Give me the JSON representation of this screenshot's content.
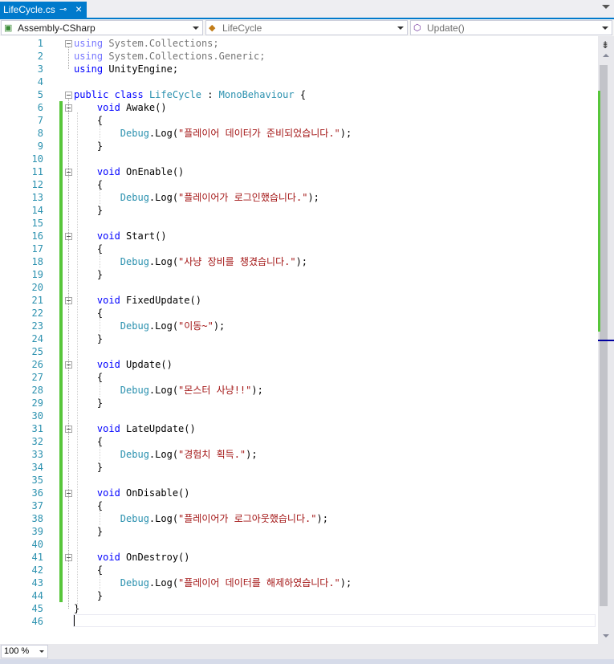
{
  "tab": {
    "title": "LifeCycle.cs",
    "pin_icon": "pin-icon",
    "close_icon": "close-icon"
  },
  "navbar": {
    "project": "Assembly-CSharp",
    "type": "LifeCycle",
    "member": "Update()"
  },
  "code_lines": [
    {
      "n": "1",
      "segs": [
        [
          "kw dim",
          "using"
        ],
        [
          "dim",
          " System.Collections;"
        ]
      ],
      "fold": true
    },
    {
      "n": "2",
      "segs": [
        [
          "kw dim",
          "using"
        ],
        [
          "dim",
          " System.Collections.Generic;"
        ]
      ]
    },
    {
      "n": "3",
      "segs": [
        [
          "kw",
          "using"
        ],
        [
          "",
          " UnityEngine;"
        ]
      ]
    },
    {
      "n": "4",
      "segs": []
    },
    {
      "n": "5",
      "segs": [
        [
          "kw",
          "public"
        ],
        [
          "",
          " "
        ],
        [
          "kw",
          "class"
        ],
        [
          "",
          " "
        ],
        [
          "ty",
          "LifeCycle"
        ],
        [
          "",
          " : "
        ],
        [
          "ty",
          "MonoBehaviour"
        ],
        [
          "",
          " {"
        ]
      ],
      "fold": true
    },
    {
      "n": "6",
      "segs": [
        [
          "",
          "    "
        ],
        [
          "kw",
          "void"
        ],
        [
          "",
          " Awake()"
        ]
      ],
      "fold": true
    },
    {
      "n": "7",
      "segs": [
        [
          "",
          "    {"
        ]
      ]
    },
    {
      "n": "8",
      "segs": [
        [
          "",
          "        "
        ],
        [
          "ty",
          "Debug"
        ],
        [
          "",
          ".Log("
        ],
        [
          "str",
          "\"플레이어 데이터가 준비되었습니다.\""
        ],
        [
          "",
          ");"
        ]
      ]
    },
    {
      "n": "9",
      "segs": [
        [
          "",
          "    }"
        ]
      ]
    },
    {
      "n": "10",
      "segs": []
    },
    {
      "n": "11",
      "segs": [
        [
          "",
          "    "
        ],
        [
          "kw",
          "void"
        ],
        [
          "",
          " OnEnable()"
        ]
      ],
      "fold": true
    },
    {
      "n": "12",
      "segs": [
        [
          "",
          "    {"
        ]
      ]
    },
    {
      "n": "13",
      "segs": [
        [
          "",
          "        "
        ],
        [
          "ty",
          "Debug"
        ],
        [
          "",
          ".Log("
        ],
        [
          "str",
          "\"플레이어가 로그인했습니다.\""
        ],
        [
          "",
          ");"
        ]
      ]
    },
    {
      "n": "14",
      "segs": [
        [
          "",
          "    }"
        ]
      ]
    },
    {
      "n": "15",
      "segs": []
    },
    {
      "n": "16",
      "segs": [
        [
          "",
          "    "
        ],
        [
          "kw",
          "void"
        ],
        [
          "",
          " Start()"
        ]
      ],
      "fold": true
    },
    {
      "n": "17",
      "segs": [
        [
          "",
          "    {"
        ]
      ]
    },
    {
      "n": "18",
      "segs": [
        [
          "",
          "        "
        ],
        [
          "ty",
          "Debug"
        ],
        [
          "",
          ".Log("
        ],
        [
          "str",
          "\"사냥 장비를 챙겼습니다.\""
        ],
        [
          "",
          ");"
        ]
      ]
    },
    {
      "n": "19",
      "segs": [
        [
          "",
          "    }"
        ]
      ]
    },
    {
      "n": "20",
      "segs": []
    },
    {
      "n": "21",
      "segs": [
        [
          "",
          "    "
        ],
        [
          "kw",
          "void"
        ],
        [
          "",
          " FixedUpdate()"
        ]
      ],
      "fold": true
    },
    {
      "n": "22",
      "segs": [
        [
          "",
          "    {"
        ]
      ]
    },
    {
      "n": "23",
      "segs": [
        [
          "",
          "        "
        ],
        [
          "ty",
          "Debug"
        ],
        [
          "",
          ".Log("
        ],
        [
          "str",
          "\"이동~\""
        ],
        [
          "",
          ");"
        ]
      ]
    },
    {
      "n": "24",
      "segs": [
        [
          "",
          "    }"
        ]
      ]
    },
    {
      "n": "25",
      "segs": []
    },
    {
      "n": "26",
      "segs": [
        [
          "",
          "    "
        ],
        [
          "kw",
          "void"
        ],
        [
          "",
          " Update()"
        ]
      ],
      "fold": true
    },
    {
      "n": "27",
      "segs": [
        [
          "",
          "    {"
        ]
      ]
    },
    {
      "n": "28",
      "segs": [
        [
          "",
          "        "
        ],
        [
          "ty",
          "Debug"
        ],
        [
          "",
          ".Log("
        ],
        [
          "str",
          "\"몬스터 사냥!!\""
        ],
        [
          "",
          ");"
        ]
      ]
    },
    {
      "n": "29",
      "segs": [
        [
          "",
          "    }"
        ]
      ]
    },
    {
      "n": "30",
      "segs": []
    },
    {
      "n": "31",
      "segs": [
        [
          "",
          "    "
        ],
        [
          "kw",
          "void"
        ],
        [
          "",
          " LateUpdate()"
        ]
      ],
      "fold": true
    },
    {
      "n": "32",
      "segs": [
        [
          "",
          "    {"
        ]
      ]
    },
    {
      "n": "33",
      "segs": [
        [
          "",
          "        "
        ],
        [
          "ty",
          "Debug"
        ],
        [
          "",
          ".Log("
        ],
        [
          "str",
          "\"경험치 획득.\""
        ],
        [
          "",
          ");"
        ]
      ]
    },
    {
      "n": "34",
      "segs": [
        [
          "",
          "    }"
        ]
      ]
    },
    {
      "n": "35",
      "segs": []
    },
    {
      "n": "36",
      "segs": [
        [
          "",
          "    "
        ],
        [
          "kw",
          "void"
        ],
        [
          "",
          " OnDisable()"
        ]
      ],
      "fold": true
    },
    {
      "n": "37",
      "segs": [
        [
          "",
          "    {"
        ]
      ]
    },
    {
      "n": "38",
      "segs": [
        [
          "",
          "        "
        ],
        [
          "ty",
          "Debug"
        ],
        [
          "",
          ".Log("
        ],
        [
          "str",
          "\"플레이어가 로그아웃했습니다.\""
        ],
        [
          "",
          ");"
        ]
      ]
    },
    {
      "n": "39",
      "segs": [
        [
          "",
          "    }"
        ]
      ]
    },
    {
      "n": "40",
      "segs": []
    },
    {
      "n": "41",
      "segs": [
        [
          "",
          "    "
        ],
        [
          "kw",
          "void"
        ],
        [
          "",
          " OnDestroy()"
        ]
      ],
      "fold": true
    },
    {
      "n": "42",
      "segs": [
        [
          "",
          "    {"
        ]
      ]
    },
    {
      "n": "43",
      "segs": [
        [
          "",
          "        "
        ],
        [
          "ty",
          "Debug"
        ],
        [
          "",
          ".Log("
        ],
        [
          "str",
          "\"플레이어 데이터를 해제하였습니다.\""
        ],
        [
          "",
          ");"
        ]
      ]
    },
    {
      "n": "44",
      "segs": [
        [
          "",
          "    }"
        ]
      ]
    },
    {
      "n": "45",
      "segs": [
        [
          "",
          "}"
        ]
      ]
    },
    {
      "n": "46",
      "segs": []
    }
  ],
  "zoom": {
    "value": "100 %"
  },
  "colors": {
    "accent": "#007acc",
    "changed": "#57c63a",
    "keyword": "#0000ff",
    "type": "#2b91af",
    "string": "#a31515"
  }
}
